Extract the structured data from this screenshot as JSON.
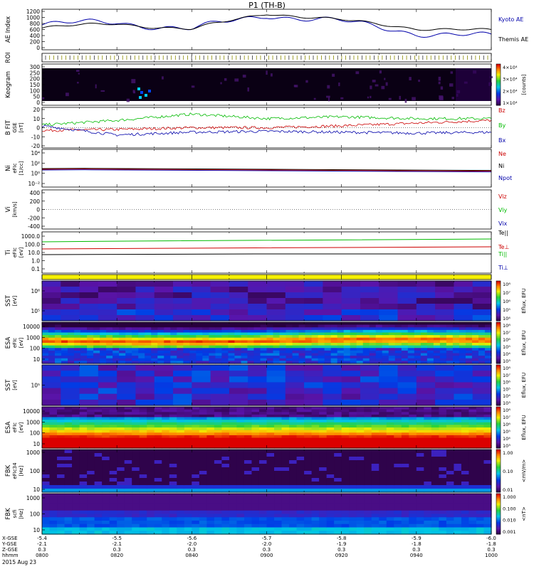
{
  "title": "P1 (TH-B)",
  "date_label": "2015 Aug 23",
  "xaxis": {
    "row_labels": [
      "X-GSE",
      "Y-GSE",
      "Z-GSE",
      "hhmm"
    ],
    "columns": [
      {
        "x": "-5.4",
        "y": "-2.1",
        "z": "0.3",
        "t": "0800"
      },
      {
        "x": "-5.5",
        "y": "-2.1",
        "z": "0.3",
        "t": "0820"
      },
      {
        "x": "-5.6",
        "y": "-2.0",
        "z": "0.3",
        "t": "0840"
      },
      {
        "x": "-5.7",
        "y": "-2.0",
        "z": "0.3",
        "t": "0900"
      },
      {
        "x": "-5.8",
        "y": "-1.9",
        "z": "0.3",
        "t": "0920"
      },
      {
        "x": "-5.9",
        "y": "-1.8",
        "z": "0.3",
        "t": "0940"
      },
      {
        "x": "-6.0",
        "y": "-1.8",
        "z": "0.3",
        "t": "1000"
      }
    ]
  },
  "panels": {
    "ae": {
      "ylabel": "AE Index",
      "ticks": [
        "1200",
        "1000",
        "800",
        "600",
        "400",
        "200",
        "0"
      ],
      "legend": [
        {
          "text": "Kyoto AE",
          "color": "#0000aa"
        },
        {
          "text": "Themis AE",
          "color": "#000000"
        }
      ]
    },
    "roi": {
      "ylabel": "ROI"
    },
    "keogram": {
      "ylabel": "Keogram",
      "ticks": [
        "300",
        "250",
        "200",
        "150",
        "100",
        "50",
        "0"
      ],
      "cbar_ticks": [
        "4×10⁴",
        "3×10⁴",
        "2×10⁴",
        "1×10⁴"
      ],
      "cbar_label": "[counts]"
    },
    "bfit": {
      "ylabel": "B FIT",
      "ylabel2": "GSE",
      "ylabel3": "[nT]",
      "ticks": [
        "20",
        "10",
        "0",
        "-10",
        "-20"
      ],
      "legend": [
        {
          "text": "Bz",
          "color": "#cc0000"
        },
        {
          "text": "By",
          "color": "#00bb00"
        },
        {
          "text": "Bx",
          "color": "#0000aa"
        }
      ]
    },
    "ni": {
      "ylabel": "Ni",
      "ylabel2": "eFIc",
      "ylabel3": "[1/cc]",
      "ticks": [
        "10⁴",
        "10²",
        "10⁰",
        "10⁻²"
      ],
      "legend": [
        {
          "text": "Ne",
          "color": "#cc0000"
        },
        {
          "text": "Ni",
          "color": "#000000"
        },
        {
          "text": "Npot",
          "color": "#0000aa"
        }
      ]
    },
    "vi": {
      "ylabel": "Vi",
      "ylabel3": "[km/s]",
      "ticks": [
        "400",
        "200",
        "0",
        "-200",
        "-400"
      ],
      "legend": [
        {
          "text": "Viz",
          "color": "#cc0000"
        },
        {
          "text": "Viy",
          "color": "#00bb00"
        },
        {
          "text": "Vix",
          "color": "#0000aa"
        }
      ]
    },
    "ti": {
      "ylabel": "Ti",
      "ylabel2": "eFIc",
      "ylabel3": "[eV]",
      "ticks": [
        "1000.0",
        "100.0",
        "10.0",
        "1.0",
        "0.1"
      ],
      "legend": [
        {
          "text": "Te||",
          "color": "#000000"
        },
        {
          "text": "Te⊥",
          "color": "#cc0000"
        },
        {
          "text": "Ti||",
          "color": "#00bb00"
        },
        {
          "text": "Ti⊥",
          "color": "#0000aa"
        }
      ]
    },
    "sst_e": {
      "ylabel": "SST",
      "ylabel3": "[eV]",
      "ticks": [
        "10⁶",
        "10⁵"
      ]
    },
    "esa_e": {
      "ylabel": "ESA",
      "ylabel2": "eFIc",
      "ylabel3": "[eV]",
      "ticks": [
        "10000",
        "1000",
        "100",
        "10"
      ]
    },
    "sst_i": {
      "ylabel": "SST",
      "ylabel3": "[eV]",
      "ticks": [
        "10⁵"
      ]
    },
    "esa_i": {
      "ylabel": "ESA",
      "ylabel2": "eFIc",
      "ylabel3": "[eV]",
      "ticks": [
        "10000",
        "1000",
        "100",
        "10"
      ]
    },
    "fbk1": {
      "ylabel": "FBK",
      "ylabel2": "eFIc34",
      "ylabel3": "[Hz]",
      "ticks": [
        "1000",
        "100",
        "10"
      ],
      "cbar_ticks": [
        "1.00",
        "0.10",
        "0.01"
      ],
      "cbar_label": "<mV/m>"
    },
    "fbk2": {
      "ylabel": "FBK",
      "ylabel2": "scfi",
      "ylabel3": "[Hz]",
      "ticks": [
        "1000",
        "100",
        "10"
      ],
      "cbar_ticks": [
        "1.000",
        "0.100",
        "0.010",
        "0.001"
      ],
      "cbar_label": "<nT>"
    }
  },
  "spec_cbar": {
    "ticks": [
      "10⁸",
      "10⁷",
      "10⁶",
      "10⁵",
      "10⁴",
      "10³"
    ],
    "label": "Eflux, EFU"
  },
  "chart_data": {
    "type": "line",
    "title": "P1 (TH-B)",
    "x": [
      "0800",
      "0820",
      "0840",
      "0900",
      "0920",
      "0940",
      "1000"
    ],
    "series": [
      {
        "name": "Kyoto AE",
        "values": [
          750,
          850,
          600,
          1100,
          850,
          500,
          350
        ]
      },
      {
        "name": "Themis AE",
        "values": [
          650,
          800,
          600,
          1150,
          900,
          650,
          550
        ]
      },
      {
        "name": "Bz",
        "values": [
          -3,
          -2,
          0,
          0,
          2,
          5,
          8
        ]
      },
      {
        "name": "By",
        "values": [
          3,
          8,
          15,
          10,
          12,
          10,
          10
        ]
      },
      {
        "name": "Bx",
        "values": [
          2,
          -8,
          -5,
          -4,
          -5,
          -6,
          -5
        ]
      }
    ],
    "ylim": [
      0,
      1200
    ]
  }
}
